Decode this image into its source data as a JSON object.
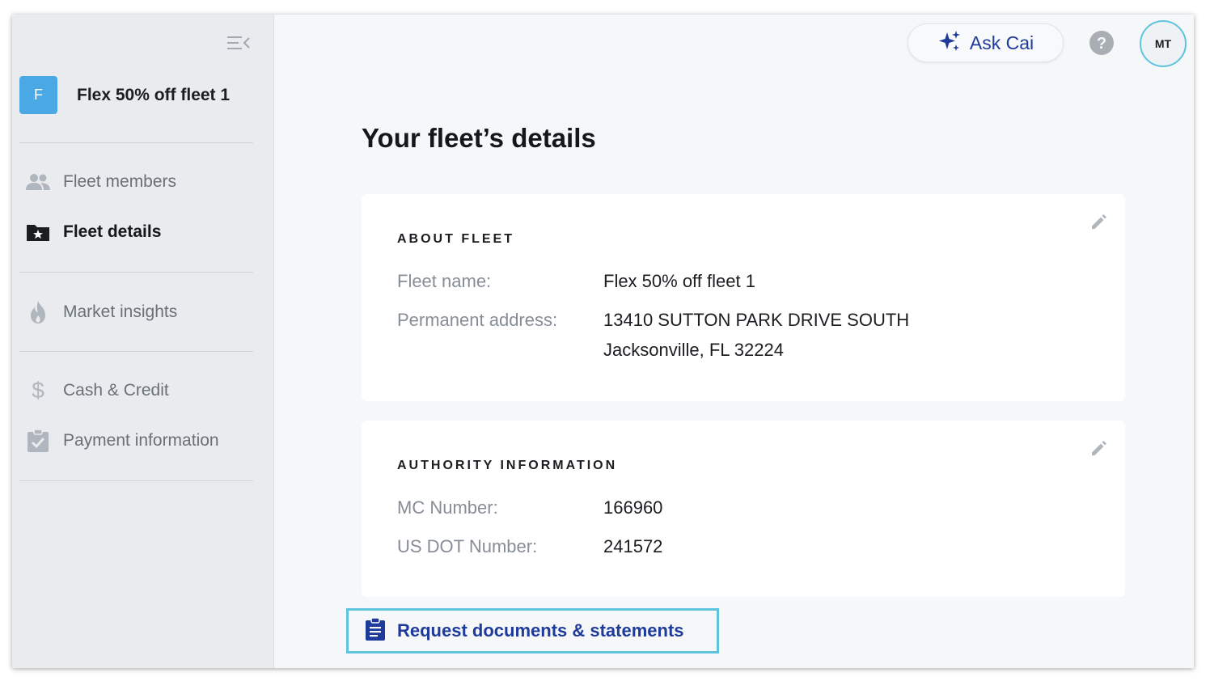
{
  "sidebar": {
    "fleet_initial": "F",
    "fleet_name": "Flex 50% off fleet 1",
    "items": [
      {
        "label": "Fleet members",
        "icon": "people-icon"
      },
      {
        "label": "Fleet details",
        "icon": "folder-star-icon",
        "active": true
      },
      {
        "label": "Market insights",
        "icon": "flame-icon"
      },
      {
        "label": "Cash & Credit",
        "icon": "dollar-icon"
      },
      {
        "label": "Payment information",
        "icon": "clipboard-check-icon"
      }
    ]
  },
  "topbar": {
    "ask_label": "Ask Cai",
    "avatar_initials": "MT"
  },
  "page": {
    "title": "Your fleet’s details"
  },
  "about": {
    "section_title": "ABOUT FLEET",
    "fleet_name_label": "Fleet name:",
    "fleet_name_value": "Flex 50% off fleet 1",
    "address_label": "Permanent address:",
    "address_line1": "13410 SUTTON PARK DRIVE SOUTH",
    "address_line2": "Jacksonville, FL 32224"
  },
  "authority": {
    "section_title": "AUTHORITY INFORMATION",
    "mc_label": "MC Number:",
    "mc_value": "166960",
    "dot_label": "US DOT Number:",
    "dot_value": "241572"
  },
  "actions": {
    "request_label": "Request documents & statements"
  },
  "colors": {
    "accent": "#1e3a9a",
    "badge": "#4aa9e5",
    "focus": "#5ec4de"
  }
}
